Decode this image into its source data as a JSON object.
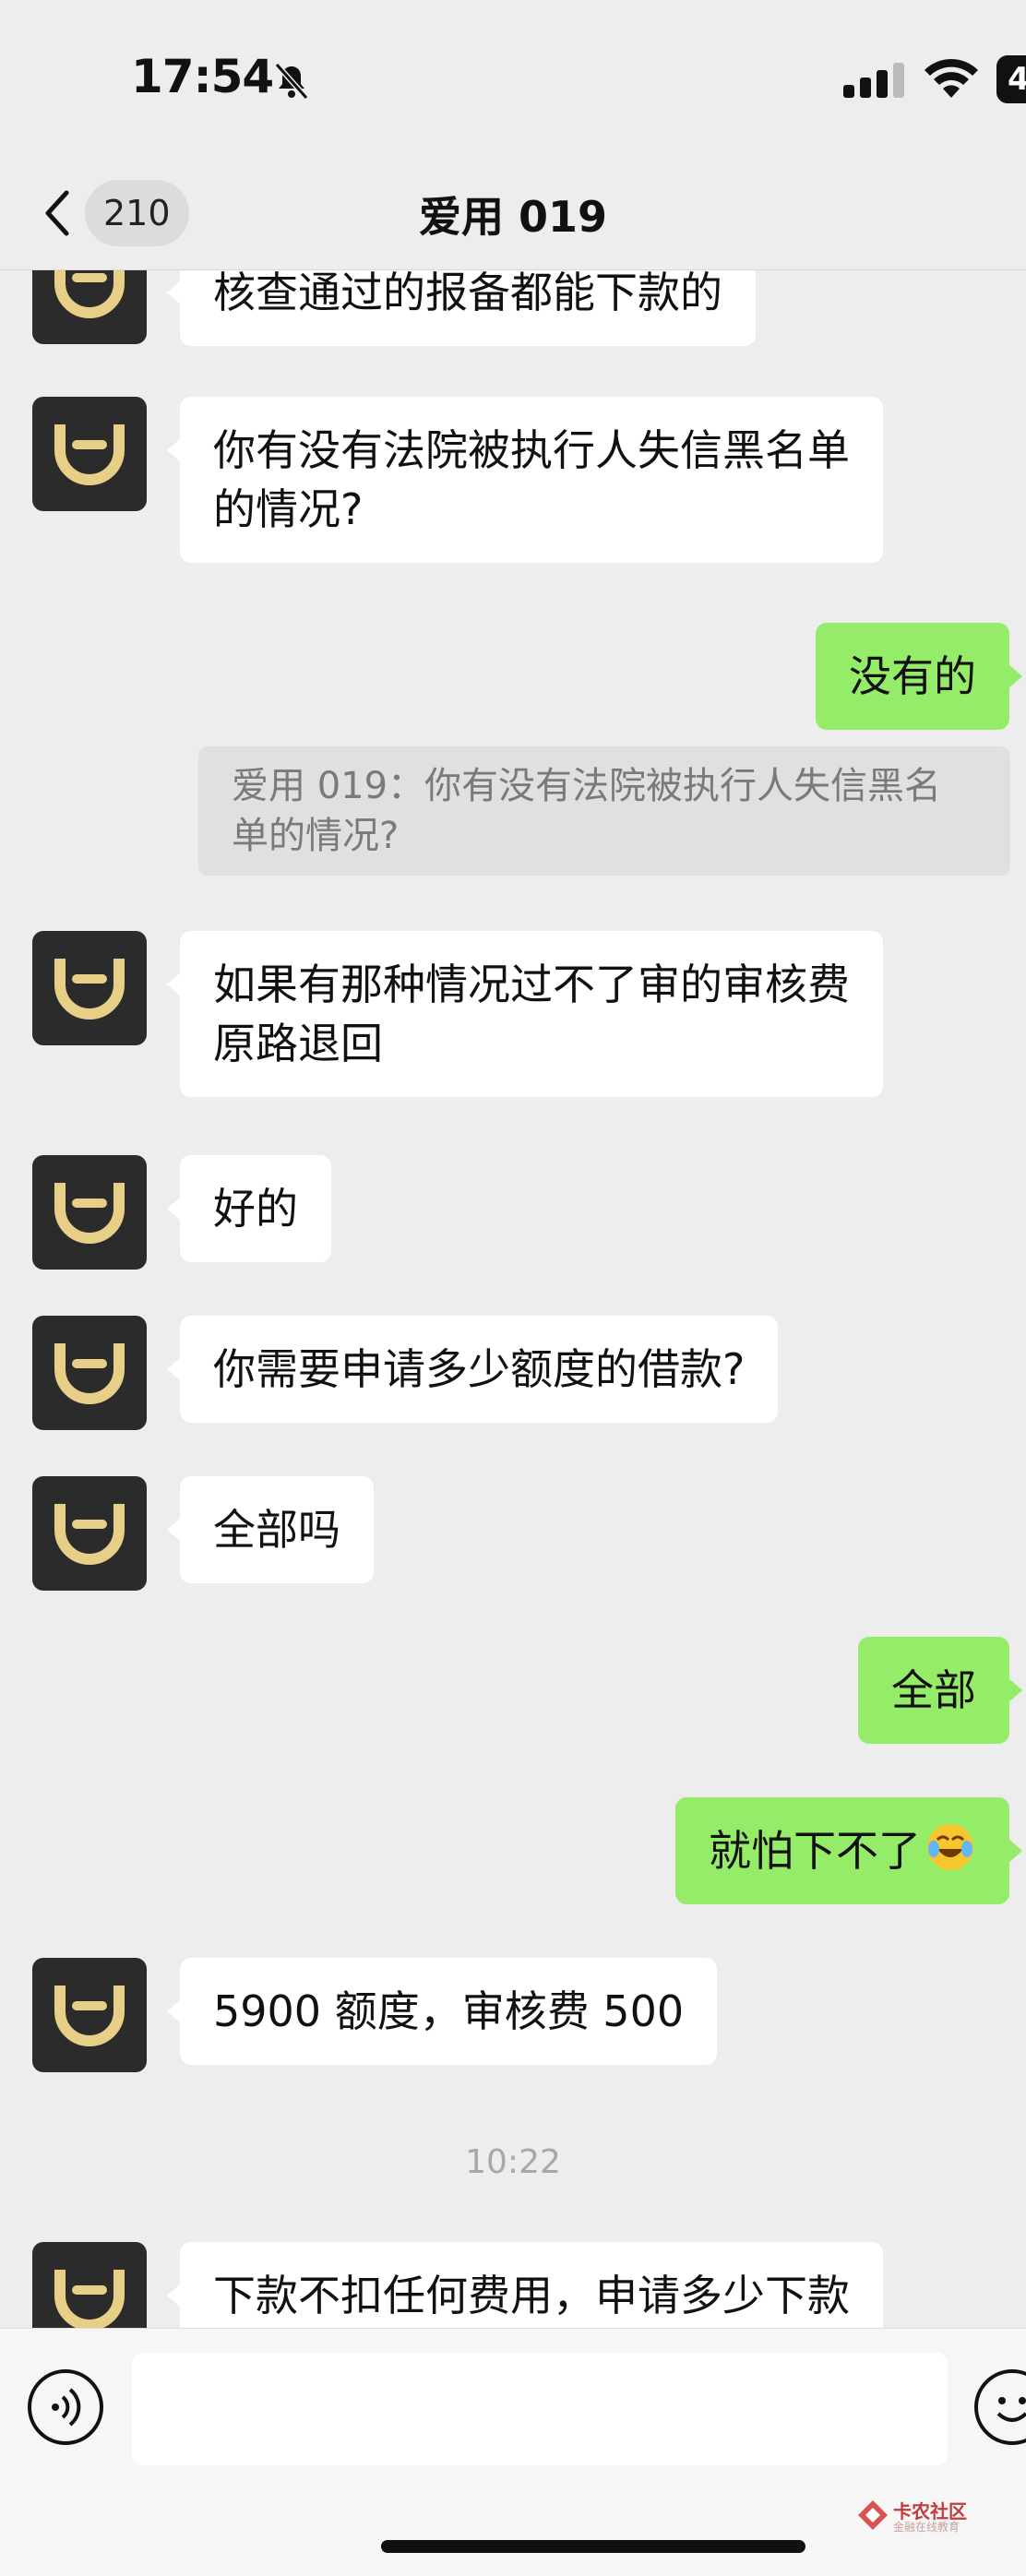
{
  "status_bar": {
    "time": "17:54",
    "battery": "4"
  },
  "nav": {
    "back_count": "210",
    "title": "爱用 019"
  },
  "messages": {
    "m1": "核查通过的报备都能下款的",
    "m2_line1": "你有没有法院被执行人失信黑名单",
    "m2_line2": "的情况?",
    "m3": "没有的",
    "m3_quote_line1": "爱用 019：你有没有法院被执行人失信黑名",
    "m3_quote_line2": "单的情况?",
    "m4_line1": "如果有那种情况过不了审的审核费",
    "m4_line2": "原路退回",
    "m5": "好的",
    "m6": "你需要申请多少额度的借款?",
    "m7": "全部吗",
    "m8": "全部",
    "m9": "就怕下不了",
    "m10": "5900 额度，审核费 500",
    "time_divider": "10:22",
    "m11": "下款不扣任何费用，申请多少下款"
  },
  "input": {
    "placeholder": ""
  },
  "watermark": {
    "name": "卡农社区",
    "sub": "金融在线教育"
  },
  "icons": {
    "bell": "bell-slash-icon",
    "signal": "cellular-signal-icon",
    "wifi": "wifi-icon",
    "back": "chevron-left-icon",
    "voice": "voice-icon",
    "emoji": "emoji-icon",
    "avatar": "app-logo-avatar"
  },
  "colors": {
    "background": "#ededed",
    "outgoing_bubble": "#95ec69",
    "incoming_bubble": "#ffffff",
    "avatar_bg": "#2b2b2b",
    "avatar_logo": "#e8cf88"
  }
}
